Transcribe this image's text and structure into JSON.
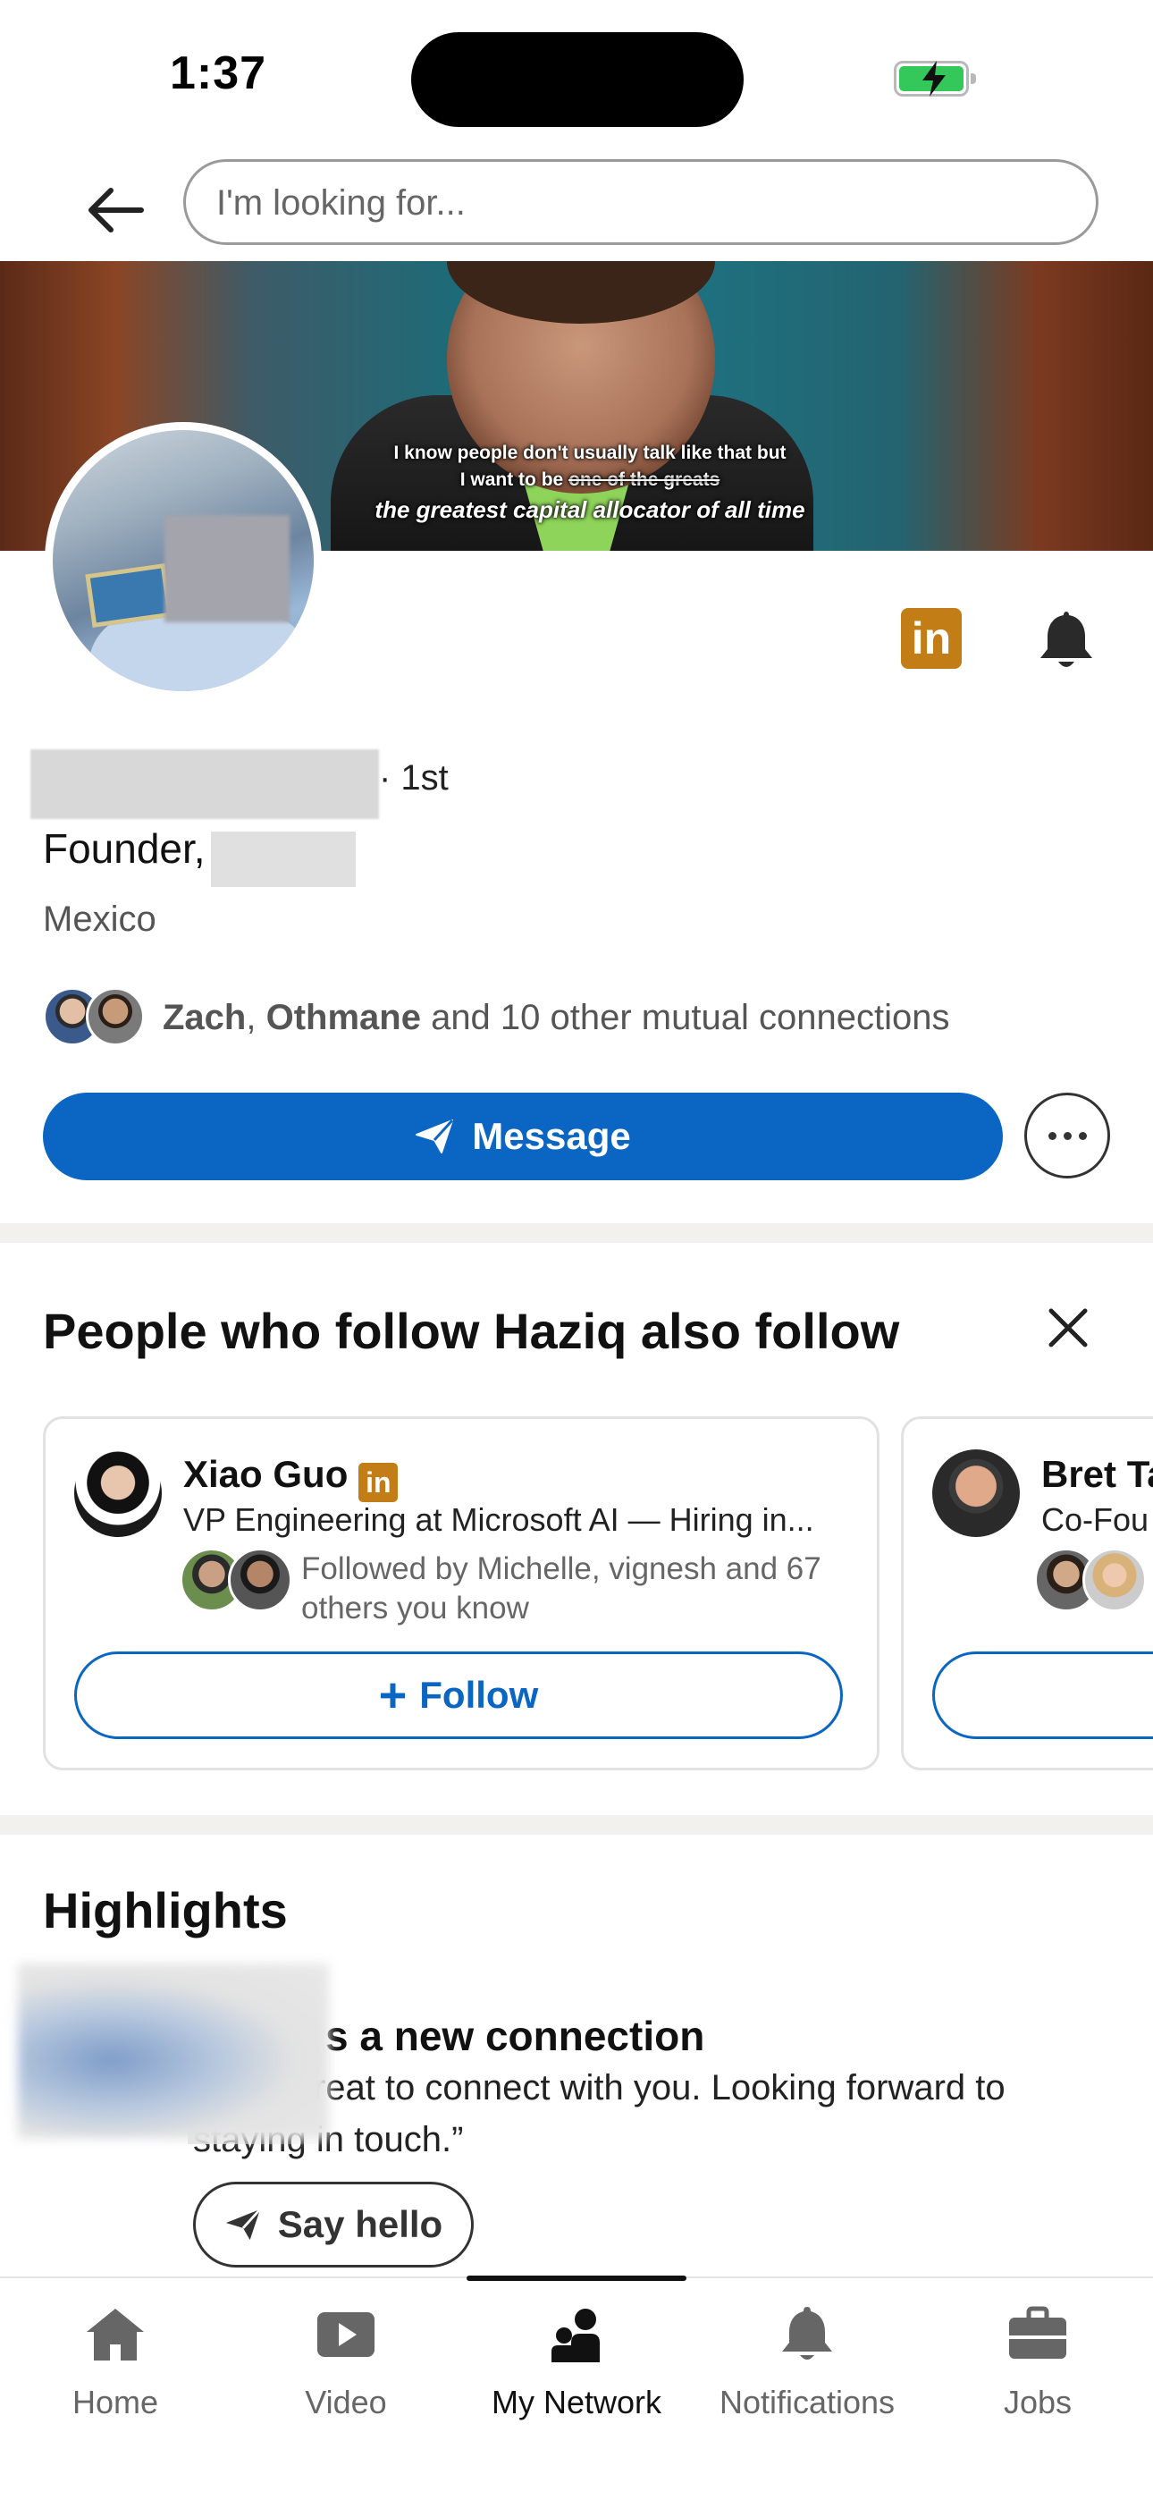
{
  "status_bar": {
    "time": "1:37"
  },
  "search": {
    "placeholder": "I'm looking for..."
  },
  "banner": {
    "caption_line1": "I know people don't usually talk like that but",
    "caption_line2_prefix": "I want to be ",
    "caption_line2_strike": "one of the greats",
    "caption_line3": "the greatest capital allocator of all time"
  },
  "profile": {
    "degree": "· 1st",
    "headline": "Founder,",
    "location": "Mexico",
    "mutual": {
      "name1": "Zach",
      "separator": ", ",
      "name2": "Othmane",
      "rest": " and 10 other mutual connections"
    },
    "message_label": "Message",
    "premium_badge": "in"
  },
  "also_follow": {
    "title": "People who follow Haziq also follow",
    "cards": [
      {
        "name": "Xiao Guo",
        "badge": "in",
        "headline": "VP Engineering at Microsoft AI — Hiring in...",
        "followed_by": "Followed by Michelle, vignesh and 67 others you know",
        "follow_label": "Follow",
        "follow_icon": "+"
      },
      {
        "name": "Bret Ta",
        "headline": "Co-Fou",
        "follow_label": "",
        "follow_icon": ""
      }
    ]
  },
  "highlights": {
    "title": "Highlights",
    "card_title": "s a new connection",
    "card_body": "iq, it’s great to connect with you. Looking forward to staying in touch.”",
    "say_hello_label": "Say hello"
  },
  "bottom_nav": {
    "items": [
      {
        "label": "Home",
        "icon": "home-icon"
      },
      {
        "label": "Video",
        "icon": "video-icon"
      },
      {
        "label": "My Network",
        "icon": "my-network-icon"
      },
      {
        "label": "Notifications",
        "icon": "bell-icon"
      },
      {
        "label": "Jobs",
        "icon": "briefcase-icon"
      }
    ],
    "active": "My Network"
  },
  "colors": {
    "primary_blue": "#0a66c2",
    "premium_gold": "#c37d16",
    "divider": "#f3f1ed",
    "battery_green": "#34c759"
  }
}
